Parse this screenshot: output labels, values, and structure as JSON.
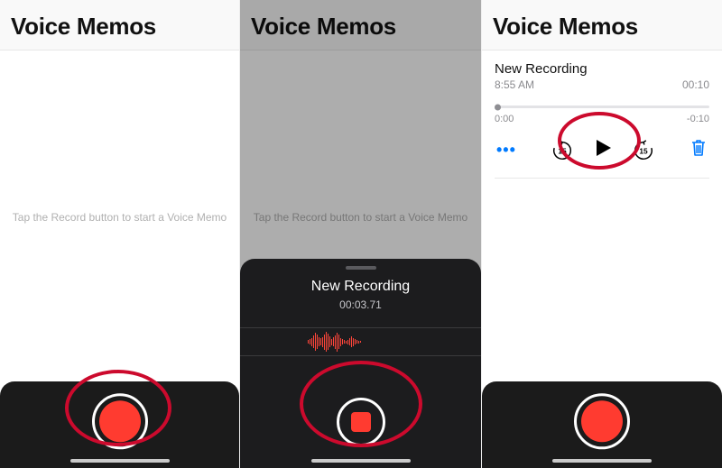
{
  "panel1": {
    "title": "Voice Memos",
    "hint": "Tap the Record button to start a Voice Memo"
  },
  "panel2": {
    "title": "Voice Memos",
    "hint": "Tap the Record button to start a Voice Memo",
    "recordingName": "New Recording",
    "elapsed": "00:03.71"
  },
  "panel3": {
    "title": "Voice Memos",
    "recording": {
      "name": "New Recording",
      "timeLabel": "8:55 AM",
      "duration": "00:10",
      "posTime": "0:00",
      "remTime": "-0:10",
      "skipBack": "15",
      "skipFwd": "15"
    }
  },
  "colors": {
    "accent": "#007aff",
    "record": "#ff3b30",
    "annotation": "#cc0a2d"
  }
}
